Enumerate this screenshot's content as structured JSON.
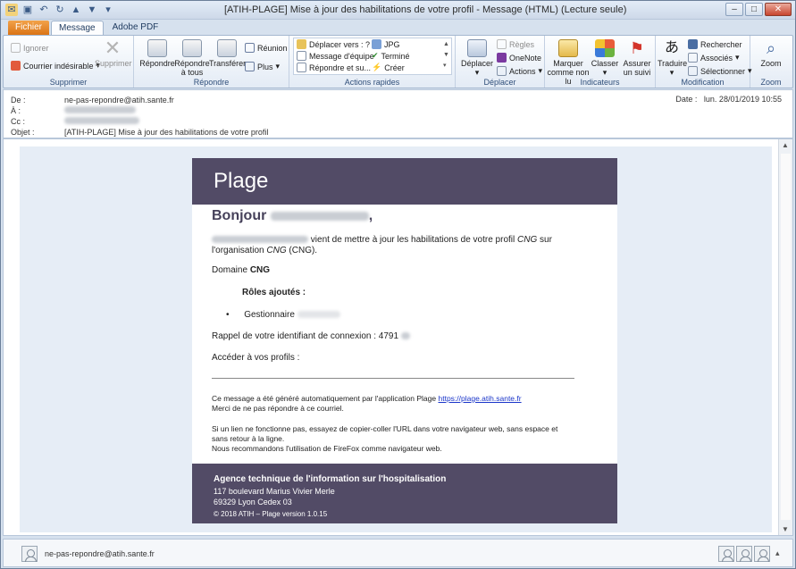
{
  "window": {
    "title": "[ATIH-PLAGE] Mise à jour des habilitations de votre profil  -  Message (HTML) (Lecture seule)",
    "controls": {
      "minimize": "–",
      "maximize": "□",
      "close": "✕"
    }
  },
  "tabs": [
    "Fichier",
    "Message",
    "Adobe PDF"
  ],
  "ribbon": {
    "supprimer": {
      "label": "Supprimer",
      "ignorer": "Ignorer",
      "courrier": "Courrier indésirable",
      "supprimer_btn": "Supprimer"
    },
    "repondre": {
      "label": "Répondre",
      "repondre_btn": "Répondre",
      "repondre_tous": "Répondre à tous",
      "transferer": "Transférer",
      "reunion": "Réunion",
      "plus": "Plus"
    },
    "actions_rapides": {
      "label": "Actions rapides",
      "deplacer_vers": "Déplacer vers : ?",
      "message_equipe": "Message d'équipe",
      "repondre_suppr": "Répondre et su...",
      "jpg": "JPG",
      "termine": "Terminé",
      "creer": "Créer"
    },
    "deplacer": {
      "label": "Déplacer",
      "deplacer_btn": "Déplacer",
      "regles": "Règles",
      "onenote": "OneNote",
      "actions": "Actions"
    },
    "indicateurs": {
      "label": "Indicateurs",
      "marquer": "Marquer comme non lu",
      "classer": "Classer",
      "assurer": "Assurer un suivi"
    },
    "modification": {
      "label": "Modification",
      "traduire": "Traduire",
      "rechercher": "Rechercher",
      "associes": "Associés",
      "selectionner": "Sélectionner"
    },
    "zoom": {
      "label": "Zoom",
      "zoom_btn": "Zoom"
    }
  },
  "header": {
    "de_label": "De :",
    "de_value": "ne-pas-repondre@atih.sante.fr",
    "a_label": "À :",
    "cc_label": "Cc :",
    "objet_label": "Objet :",
    "objet_value": "[ATIH-PLAGE] Mise à jour des habilitations de votre profil",
    "date_label": "Date :",
    "date_value": "lun. 28/01/2019 10:55"
  },
  "email": {
    "brand": "Plage",
    "greeting": "Bonjour",
    "greeting_end": ",",
    "line1a": "vient de mettre à jour les habilitations de votre profil",
    "line1_cng": "CNG",
    "line1b": "sur",
    "line2a": "l'organisation",
    "line2_cng": "CNG",
    "line2b": "(CNG).",
    "domaine_label": "Domaine",
    "domaine_value": "CNG",
    "roles_title": "Rôles ajoutés :",
    "role_item": "Gestionnaire",
    "identifiant": "Rappel de votre identifiant de connexion : 4791",
    "acceder": "Accéder à vos profils :",
    "profil_link": "https://plage.atih.sante.fr/#/utilisateur/mon-compte/utilisateur/profil/list",
    "auto_msg": "Ce message a été généré automatiquement par l'application Plage",
    "plage_link": "https://plage.atih.sante.fr",
    "no_reply": "Merci de ne pas répondre à ce courriel.",
    "tip1": "Si un lien ne fonctionne pas, essayez de copier-coller l'URL dans votre navigateur web, sans espace et",
    "tip2": "sans retour à la ligne.",
    "tip3": "Nous recommandons l'utilisation de FireFox comme navigateur web.",
    "footer_org": "Agence technique de l'information sur l'hospitalisation",
    "footer_addr1": "117 boulevard Marius Vivier Merle",
    "footer_addr2": "69329 Lyon Cedex 03",
    "footer_copy": "© 2018 ATIH – Plage version 1.0.15"
  },
  "people_pane": {
    "sender": "ne-pas-repondre@atih.sante.fr"
  },
  "colors": {
    "brand": "#524b66",
    "link": "#1a35c9",
    "file_tab": "#d97112"
  }
}
